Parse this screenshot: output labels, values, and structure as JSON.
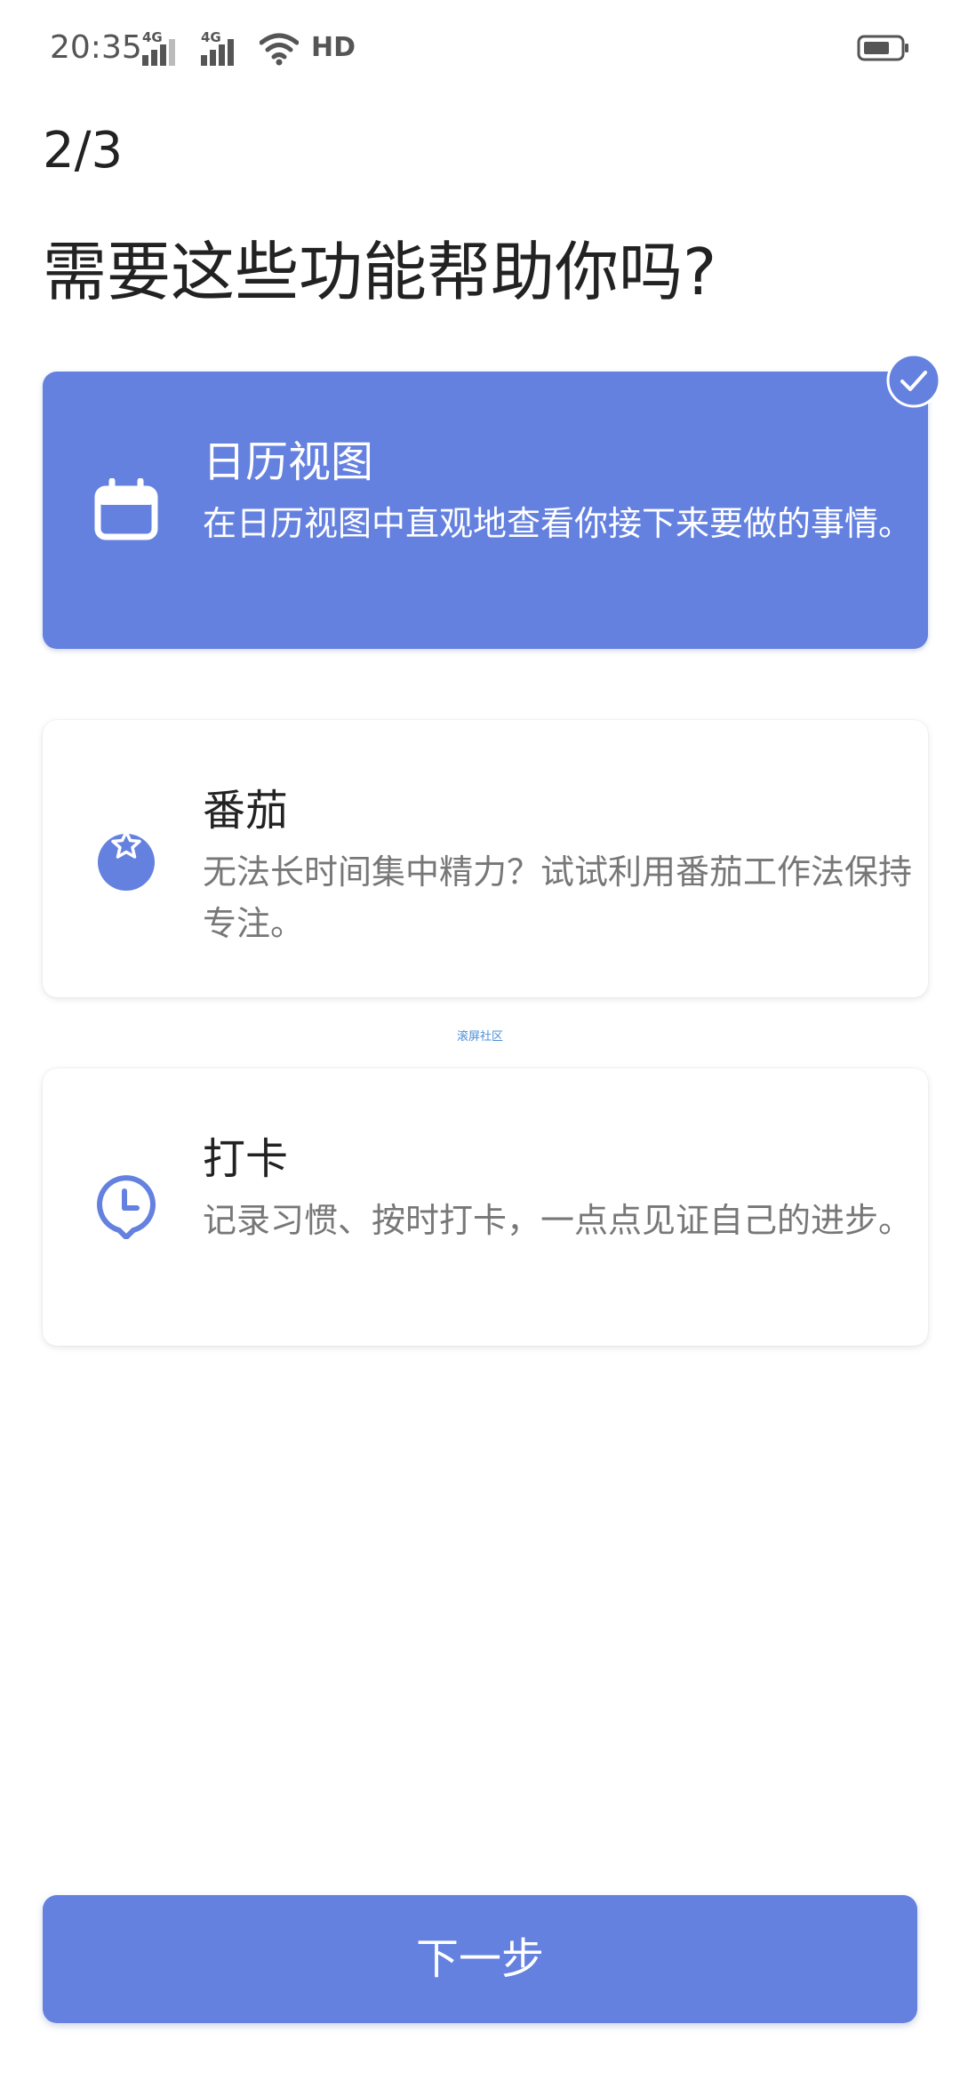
{
  "status_bar": {
    "time": "20:35",
    "signal1_label": "4G",
    "signal2_label": "4G",
    "hd_label": "HD",
    "icons": [
      "signal-icon",
      "signal-icon",
      "wifi-icon",
      "hd-icon",
      "battery-icon"
    ]
  },
  "header": {
    "step": "2/3",
    "title": "需要这些功能帮助你吗?"
  },
  "features": [
    {
      "title": "日历视图",
      "description": "在日历视图中直观地查看你接下来要做的事情。",
      "icon": "calendar-icon",
      "selected": true
    },
    {
      "title": "番茄",
      "description": "无法长时间集中精力？试试利用番茄工作法保持专注。",
      "icon": "tomato-icon",
      "selected": false
    },
    {
      "title": "打卡",
      "description": "记录习惯、按时打卡，一点点见证自己的进步。",
      "icon": "clock-icon",
      "selected": false
    }
  ],
  "watermark": "滚屏社区",
  "footer": {
    "next_label": "下一步"
  },
  "colors": {
    "accent": "#6481e0",
    "selected_text": "#ffffff",
    "title_text": "#222222",
    "desc_text": "#777777"
  }
}
